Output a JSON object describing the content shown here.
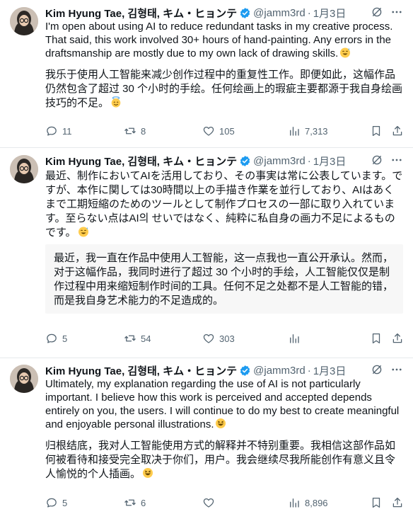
{
  "tweets": [
    {
      "author": {
        "name": "Kim Hyung Tae, 김형태, キム・ヒョンテ",
        "handle": "@jamm3rd",
        "time": "1月3日"
      },
      "text": "I'm open about using AI to reduce redundant tasks in my creative process. That said, this work involved 30+ hours of hand-painting. Any errors in the draftsmanship are mostly due to my own lack of drawing skills.",
      "translation": "我乐于使用人工智能来减少创作过程中的重复性工作。即便如此，这幅作品仍然包含了超过 30 个小时的手绘。任何绘画上的瑕疵主要都源于我自身绘画技巧的不足。",
      "stats": {
        "replies": "11",
        "retweets": "8",
        "likes": "105",
        "views": "7,313"
      }
    },
    {
      "author": {
        "name": "Kim Hyung Tae, 김형태, キム・ヒョンテ",
        "handle": "@jamm3rd",
        "time": "1月3日"
      },
      "text": "最近、制作においてAIを活用しており、その事実は常に公表しています。ですが、本作に関しては30時間以上の手描き作業を並行しており、AIはあくまで工期短縮のためのツールとして制作プロセスの一部に取り入れています。至らない点はAI의 せいではなく、純粋に私自身の画力不足によるものです。",
      "translation": "最近，我一直在作品中使用人工智能，这一点我也一直公开承认。然而，对于这幅作品，我同时进行了超过 30 个小时的手绘，人工智能仅仅是制作过程中用来缩短制作时间的工具。任何不足之处都不是人工智能的错，而是我自身艺术能力的不足造成的。",
      "stats": {
        "replies": "5",
        "retweets": "54",
        "likes": "303",
        "views": ""
      }
    },
    {
      "author": {
        "name": "Kim Hyung Tae, 김형태, キム・ヒョンテ",
        "handle": "@jamm3rd",
        "time": "1月3日"
      },
      "text": "Ultimately, my explanation regarding the use of AI is not particularly important. I believe how this work is perceived and accepted depends entirely on you, the users. I will continue to do my best to create meaningful and enjoyable personal illustrations.",
      "translation": "归根结底，我对人工智能使用方式的解释并不特别重要。我相信这部作品如何被看待和接受完全取决于你们，用户。我会继续尽我所能创作有意义且令人愉悦的个人插画。",
      "stats": {
        "replies": "5",
        "retweets": "6",
        "likes": "",
        "views": "8,896"
      }
    }
  ],
  "icons": {
    "verified": "verified-badge-icon",
    "grok": "grok-icon",
    "more": "more-icon",
    "reply": "reply-icon",
    "retweet": "retweet-icon",
    "like": "like-icon",
    "views": "views-icon",
    "bookmark": "bookmark-icon",
    "share": "share-icon"
  },
  "colors": {
    "verified": "#1d9bf0",
    "muted": "#536471",
    "text": "#0f1419",
    "quote_bg": "#f7f7f7",
    "divider": "#e6e9ec"
  }
}
